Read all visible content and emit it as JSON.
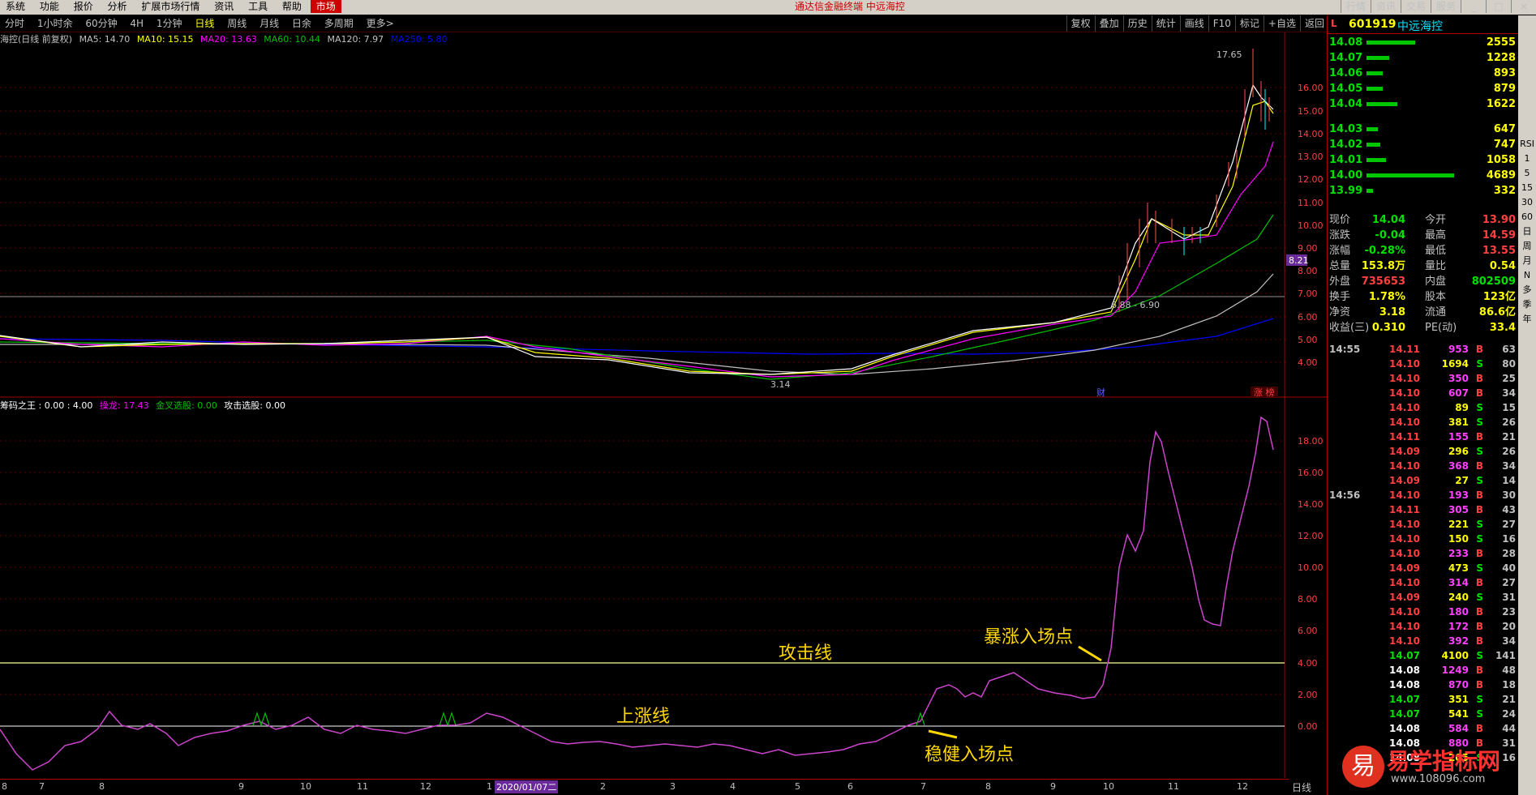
{
  "menu": [
    "系统",
    "功能",
    "报价",
    "分析",
    "扩展市场行情",
    "资讯",
    "工具",
    "帮助",
    "市场"
  ],
  "app_title": "通达信金融终端  中远海控",
  "right_menu": [
    "行情",
    "资讯",
    "交易",
    "服务"
  ],
  "periods": [
    "分时",
    "1小时余",
    "60分钟",
    "4H",
    "1分钟",
    "日线",
    "周线",
    "月线",
    "日余",
    "多周期",
    "更多>"
  ],
  "tools": [
    "复权",
    "叠加",
    "历史",
    "统计",
    "画线",
    "F10",
    "标记",
    "+自选",
    "返回"
  ],
  "main_legend": {
    "title": "海控(日线 前复权)",
    "ma5": "MA5: 14.70",
    "ma10": "MA10: 15.15",
    "ma20": "MA20: 13.63",
    "ma60": "MA60: 10.44",
    "ma120": "MA120: 7.97",
    "ma250": "MA250: 5.80"
  },
  "main_axis": [
    "16.00",
    "15.00",
    "14.00",
    "13.00",
    "12.00",
    "11.00",
    "10.00",
    "9.00",
    "8.00",
    "7.00",
    "6.00",
    "5.00",
    "4.00"
  ],
  "price_marks": {
    "high": "17.65",
    "low": "3.14",
    "range": "6.88 - 6.90",
    "cursor": "8.21",
    "tag1": "财",
    "tag2": "涨 榜"
  },
  "ind_legend": {
    "name": "筹码之王 : 0.00 : 4.00",
    "lz": "操龙: 17.43",
    "jc": "金叉选股: 0.00",
    "gj": "攻击选股: 0.00"
  },
  "ind_axis": [
    "18.00",
    "16.00",
    "14.00",
    "12.00",
    "10.00",
    "8.00",
    "6.00",
    "4.00",
    "2.00",
    "0.00"
  ],
  "annotations": {
    "attack_line": "攻击线",
    "up_line": "上涨线",
    "surge_entry": "暴涨入场点",
    "steady_entry": "稳健入场点"
  },
  "date_axis": [
    "8",
    "7",
    "8",
    "9",
    "10",
    "11",
    "12",
    "1",
    "2",
    "3",
    "4",
    "5",
    "6",
    "7",
    "8",
    "9",
    "10",
    "11",
    "12",
    "1"
  ],
  "date_selected": "2020/01/07二",
  "day_label": "日线",
  "stock": {
    "flag": "L",
    "code": "601919",
    "name": "中远海控"
  },
  "asks": [
    {
      "price": "14.08",
      "vol": "2555",
      "w": 60
    },
    {
      "price": "14.07",
      "vol": "1228",
      "w": 28
    },
    {
      "price": "14.06",
      "vol": "893",
      "w": 20
    },
    {
      "price": "14.05",
      "vol": "879",
      "w": 20
    },
    {
      "price": "14.04",
      "vol": "1622",
      "w": 38
    }
  ],
  "bids": [
    {
      "price": "14.03",
      "vol": "647",
      "w": 14
    },
    {
      "price": "14.02",
      "vol": "747",
      "w": 17
    },
    {
      "price": "14.01",
      "vol": "1058",
      "w": 24
    },
    {
      "price": "14.00",
      "vol": "4689",
      "w": 108
    },
    {
      "price": "13.99",
      "vol": "332",
      "w": 8
    }
  ],
  "quote": [
    {
      "l": "现价",
      "v": "14.04",
      "vc": "#00e000",
      "l2": "今开",
      "v2": "13.90",
      "v2c": "#ff4040"
    },
    {
      "l": "涨跌",
      "v": "-0.04",
      "vc": "#00e000",
      "l2": "最高",
      "v2": "14.59",
      "v2c": "#ff4040"
    },
    {
      "l": "涨幅",
      "v": "-0.28%",
      "vc": "#00e000",
      "l2": "最低",
      "v2": "13.55",
      "v2c": "#ff4040"
    },
    {
      "l": "总量",
      "v": "153.8万",
      "vc": "#ffff00",
      "l2": "量比",
      "v2": "0.54",
      "v2c": "#ffff00"
    },
    {
      "l": "外盘",
      "v": "735653",
      "vc": "#ff4040",
      "l2": "内盘",
      "v2": "802509",
      "v2c": "#00e000"
    },
    {
      "l": "换手",
      "v": "1.78%",
      "vc": "#ffff00",
      "l2": "股本",
      "v2": "123亿",
      "v2c": "#ffff00"
    },
    {
      "l": "净资",
      "v": "3.18",
      "vc": "#ffff00",
      "l2": "流通",
      "v2": "86.6亿",
      "v2c": "#ffff00"
    },
    {
      "l": "收益(三)",
      "v": "0.310",
      "vc": "#ffff00",
      "l2": "PE(动)",
      "v2": "33.4",
      "v2c": "#ffff00"
    }
  ],
  "ticks": [
    {
      "t": "14:55",
      "p": "14.11",
      "v": "953",
      "s": "B",
      "n": "63"
    },
    {
      "t": "",
      "p": "14.10",
      "v": "1694",
      "s": "S",
      "n": "80"
    },
    {
      "t": "",
      "p": "14.10",
      "v": "350",
      "s": "B",
      "n": "25"
    },
    {
      "t": "",
      "p": "14.10",
      "v": "607",
      "s": "B",
      "n": "34"
    },
    {
      "t": "",
      "p": "14.10",
      "v": "89",
      "s": "S",
      "n": "15"
    },
    {
      "t": "",
      "p": "14.10",
      "v": "381",
      "s": "S",
      "n": "26"
    },
    {
      "t": "",
      "p": "14.11",
      "v": "155",
      "s": "B",
      "n": "21"
    },
    {
      "t": "",
      "p": "14.09",
      "v": "296",
      "s": "S",
      "n": "26"
    },
    {
      "t": "",
      "p": "14.10",
      "v": "368",
      "s": "B",
      "n": "34"
    },
    {
      "t": "",
      "p": "14.09",
      "v": "27",
      "s": "S",
      "n": "14"
    },
    {
      "t": "14:56",
      "p": "14.10",
      "v": "193",
      "s": "B",
      "n": "30"
    },
    {
      "t": "",
      "p": "14.11",
      "v": "305",
      "s": "B",
      "n": "43"
    },
    {
      "t": "",
      "p": "14.10",
      "v": "221",
      "s": "S",
      "n": "27"
    },
    {
      "t": "",
      "p": "14.10",
      "v": "150",
      "s": "S",
      "n": "16"
    },
    {
      "t": "",
      "p": "14.10",
      "v": "233",
      "s": "B",
      "n": "28"
    },
    {
      "t": "",
      "p": "14.09",
      "v": "473",
      "s": "S",
      "n": "40"
    },
    {
      "t": "",
      "p": "14.10",
      "v": "314",
      "s": "B",
      "n": "27"
    },
    {
      "t": "",
      "p": "14.09",
      "v": "240",
      "s": "S",
      "n": "31"
    },
    {
      "t": "",
      "p": "14.10",
      "v": "180",
      "s": "B",
      "n": "23"
    },
    {
      "t": "",
      "p": "14.10",
      "v": "172",
      "s": "B",
      "n": "20"
    },
    {
      "t": "",
      "p": "14.10",
      "v": "392",
      "s": "B",
      "n": "34"
    },
    {
      "t": "",
      "p": "14.07",
      "v": "4100",
      "s": "S",
      "n": "141"
    },
    {
      "t": "",
      "p": "14.08",
      "v": "1249",
      "s": "B",
      "n": "48"
    },
    {
      "t": "",
      "p": "14.08",
      "v": "870",
      "s": "B",
      "n": "18"
    },
    {
      "t": "",
      "p": "14.07",
      "v": "351",
      "s": "S",
      "n": "21"
    },
    {
      "t": "",
      "p": "14.07",
      "v": "541",
      "s": "S",
      "n": "24"
    },
    {
      "t": "",
      "p": "14.08",
      "v": "584",
      "s": "B",
      "n": "44"
    },
    {
      "t": "",
      "p": "14.08",
      "v": "880",
      "s": "B",
      "n": "31"
    },
    {
      "t": "",
      "p": "14.08",
      "v": "205",
      "s": "S",
      "n": "16"
    }
  ],
  "sidebar": [
    "RSI",
    "1",
    "5",
    "15",
    "30",
    "60",
    "日",
    "周",
    "月",
    "N",
    "多",
    "季",
    "年"
  ],
  "watermark": {
    "logo": "易",
    "site": "易学指标网",
    "url": "www.108096.com"
  },
  "colors": {
    "up": "#ff4040",
    "down": "#00e000",
    "grid": "#600000",
    "ma5": "#ffffff",
    "ma10": "#ffff00",
    "ma20": "#ff00ff",
    "ma60": "#00c000",
    "ma120": "#c0c0c0",
    "ma250": "#0000ff",
    "indicator": "#cc44cc"
  }
}
